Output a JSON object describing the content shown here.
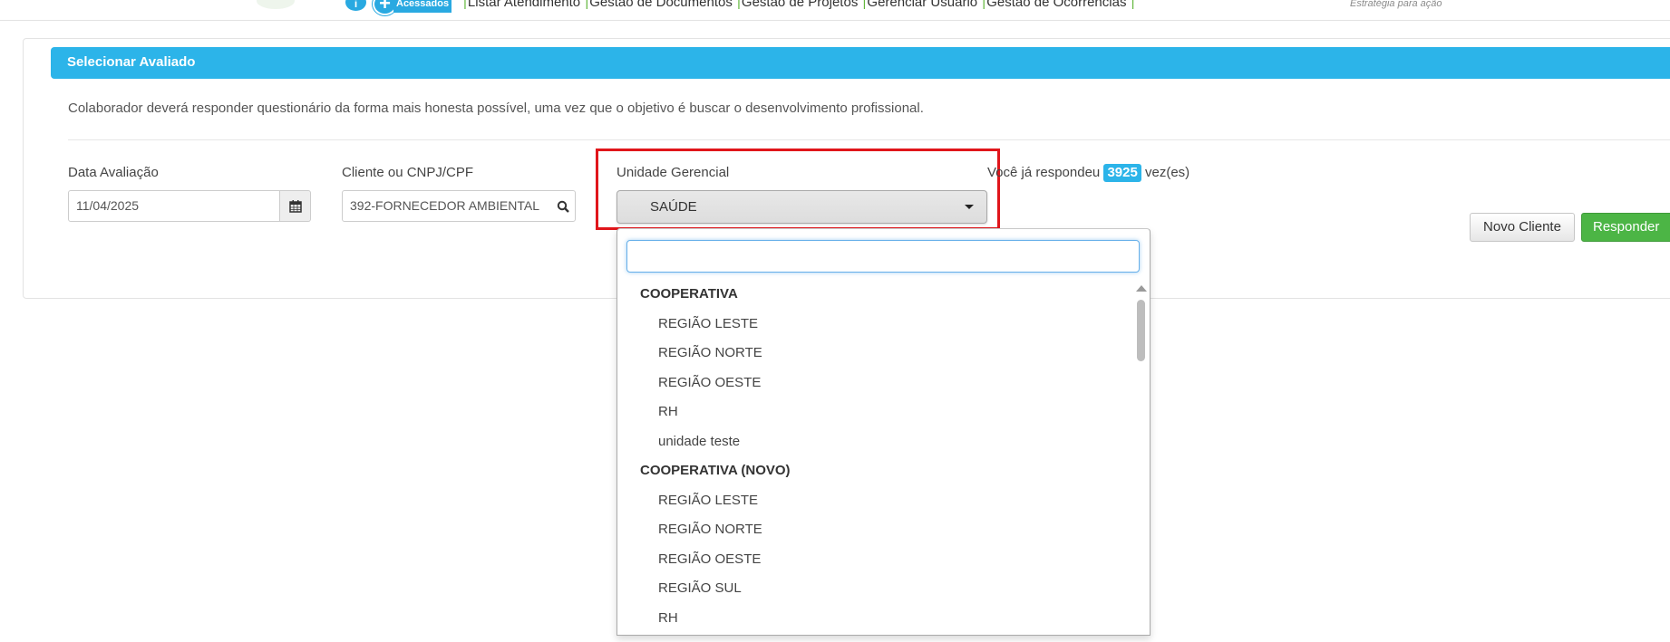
{
  "nav": {
    "info_icon": "info-icon",
    "plus_icon": "plus-icon",
    "acessados": "Acessados",
    "menu": [
      "Listar Atendimento",
      "Gestão de Documentos",
      "Gestão de Projetos",
      "Gerenciar Usuário",
      "Gestão de Ocorrências"
    ],
    "tagline": "Estratégia para ação"
  },
  "panel": {
    "title": "Selecionar Avaliado",
    "description": "Colaborador deverá responder questionário da forma mais honesta possível, uma vez que o objetivo é buscar o desenvolvimento profissional."
  },
  "form": {
    "date_label": "Data Avaliação",
    "date_value": "11/04/2025",
    "client_label": "Cliente ou CNPJ/CPF",
    "client_value": "392-FORNECEDOR AMBIENTAL",
    "unit_label": "Unidade Gerencial",
    "unit_value": "SAÚDE",
    "answered_prefix": "Você já respondeu",
    "answered_count": "3925",
    "answered_suffix": "vez(es)"
  },
  "buttons": {
    "new_client": "Novo Cliente",
    "respond": "Responder"
  },
  "dropdown": {
    "search_value": "",
    "groups": [
      {
        "label": "COOPERATIVA",
        "options": [
          "REGIÃO LESTE",
          "REGIÃO NORTE",
          "REGIÃO OESTE",
          "RH",
          "unidade teste"
        ]
      },
      {
        "label": "COOPERATIVA (NOVO)",
        "options": [
          "REGIÃO LESTE",
          "REGIÃO NORTE",
          "REGIÃO OESTE",
          "REGIÃO SUL",
          "RH"
        ]
      }
    ]
  },
  "colors": {
    "primary": "#2cb4e9",
    "success": "#4cb545",
    "highlight": "#e0161b",
    "nav_separator": "#63b83d"
  }
}
